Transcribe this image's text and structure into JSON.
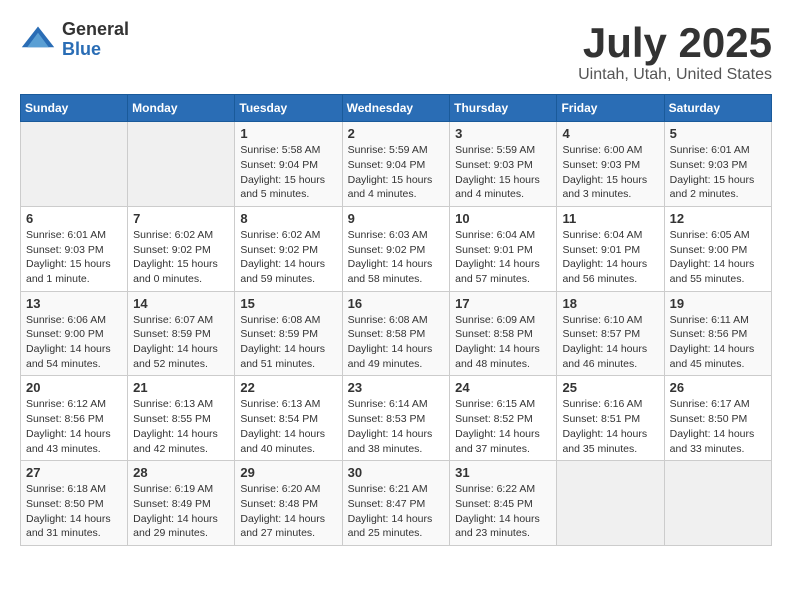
{
  "logo": {
    "general": "General",
    "blue": "Blue"
  },
  "title": "July 2025",
  "subtitle": "Uintah, Utah, United States",
  "weekdays": [
    "Sunday",
    "Monday",
    "Tuesday",
    "Wednesday",
    "Thursday",
    "Friday",
    "Saturday"
  ],
  "weeks": [
    [
      {
        "day": "",
        "info": ""
      },
      {
        "day": "",
        "info": ""
      },
      {
        "day": "1",
        "info": "Sunrise: 5:58 AM\nSunset: 9:04 PM\nDaylight: 15 hours and 5 minutes."
      },
      {
        "day": "2",
        "info": "Sunrise: 5:59 AM\nSunset: 9:04 PM\nDaylight: 15 hours and 4 minutes."
      },
      {
        "day": "3",
        "info": "Sunrise: 5:59 AM\nSunset: 9:03 PM\nDaylight: 15 hours and 4 minutes."
      },
      {
        "day": "4",
        "info": "Sunrise: 6:00 AM\nSunset: 9:03 PM\nDaylight: 15 hours and 3 minutes."
      },
      {
        "day": "5",
        "info": "Sunrise: 6:01 AM\nSunset: 9:03 PM\nDaylight: 15 hours and 2 minutes."
      }
    ],
    [
      {
        "day": "6",
        "info": "Sunrise: 6:01 AM\nSunset: 9:03 PM\nDaylight: 15 hours and 1 minute."
      },
      {
        "day": "7",
        "info": "Sunrise: 6:02 AM\nSunset: 9:02 PM\nDaylight: 15 hours and 0 minutes."
      },
      {
        "day": "8",
        "info": "Sunrise: 6:02 AM\nSunset: 9:02 PM\nDaylight: 14 hours and 59 minutes."
      },
      {
        "day": "9",
        "info": "Sunrise: 6:03 AM\nSunset: 9:02 PM\nDaylight: 14 hours and 58 minutes."
      },
      {
        "day": "10",
        "info": "Sunrise: 6:04 AM\nSunset: 9:01 PM\nDaylight: 14 hours and 57 minutes."
      },
      {
        "day": "11",
        "info": "Sunrise: 6:04 AM\nSunset: 9:01 PM\nDaylight: 14 hours and 56 minutes."
      },
      {
        "day": "12",
        "info": "Sunrise: 6:05 AM\nSunset: 9:00 PM\nDaylight: 14 hours and 55 minutes."
      }
    ],
    [
      {
        "day": "13",
        "info": "Sunrise: 6:06 AM\nSunset: 9:00 PM\nDaylight: 14 hours and 54 minutes."
      },
      {
        "day": "14",
        "info": "Sunrise: 6:07 AM\nSunset: 8:59 PM\nDaylight: 14 hours and 52 minutes."
      },
      {
        "day": "15",
        "info": "Sunrise: 6:08 AM\nSunset: 8:59 PM\nDaylight: 14 hours and 51 minutes."
      },
      {
        "day": "16",
        "info": "Sunrise: 6:08 AM\nSunset: 8:58 PM\nDaylight: 14 hours and 49 minutes."
      },
      {
        "day": "17",
        "info": "Sunrise: 6:09 AM\nSunset: 8:58 PM\nDaylight: 14 hours and 48 minutes."
      },
      {
        "day": "18",
        "info": "Sunrise: 6:10 AM\nSunset: 8:57 PM\nDaylight: 14 hours and 46 minutes."
      },
      {
        "day": "19",
        "info": "Sunrise: 6:11 AM\nSunset: 8:56 PM\nDaylight: 14 hours and 45 minutes."
      }
    ],
    [
      {
        "day": "20",
        "info": "Sunrise: 6:12 AM\nSunset: 8:56 PM\nDaylight: 14 hours and 43 minutes."
      },
      {
        "day": "21",
        "info": "Sunrise: 6:13 AM\nSunset: 8:55 PM\nDaylight: 14 hours and 42 minutes."
      },
      {
        "day": "22",
        "info": "Sunrise: 6:13 AM\nSunset: 8:54 PM\nDaylight: 14 hours and 40 minutes."
      },
      {
        "day": "23",
        "info": "Sunrise: 6:14 AM\nSunset: 8:53 PM\nDaylight: 14 hours and 38 minutes."
      },
      {
        "day": "24",
        "info": "Sunrise: 6:15 AM\nSunset: 8:52 PM\nDaylight: 14 hours and 37 minutes."
      },
      {
        "day": "25",
        "info": "Sunrise: 6:16 AM\nSunset: 8:51 PM\nDaylight: 14 hours and 35 minutes."
      },
      {
        "day": "26",
        "info": "Sunrise: 6:17 AM\nSunset: 8:50 PM\nDaylight: 14 hours and 33 minutes."
      }
    ],
    [
      {
        "day": "27",
        "info": "Sunrise: 6:18 AM\nSunset: 8:50 PM\nDaylight: 14 hours and 31 minutes."
      },
      {
        "day": "28",
        "info": "Sunrise: 6:19 AM\nSunset: 8:49 PM\nDaylight: 14 hours and 29 minutes."
      },
      {
        "day": "29",
        "info": "Sunrise: 6:20 AM\nSunset: 8:48 PM\nDaylight: 14 hours and 27 minutes."
      },
      {
        "day": "30",
        "info": "Sunrise: 6:21 AM\nSunset: 8:47 PM\nDaylight: 14 hours and 25 minutes."
      },
      {
        "day": "31",
        "info": "Sunrise: 6:22 AM\nSunset: 8:45 PM\nDaylight: 14 hours and 23 minutes."
      },
      {
        "day": "",
        "info": ""
      },
      {
        "day": "",
        "info": ""
      }
    ]
  ]
}
